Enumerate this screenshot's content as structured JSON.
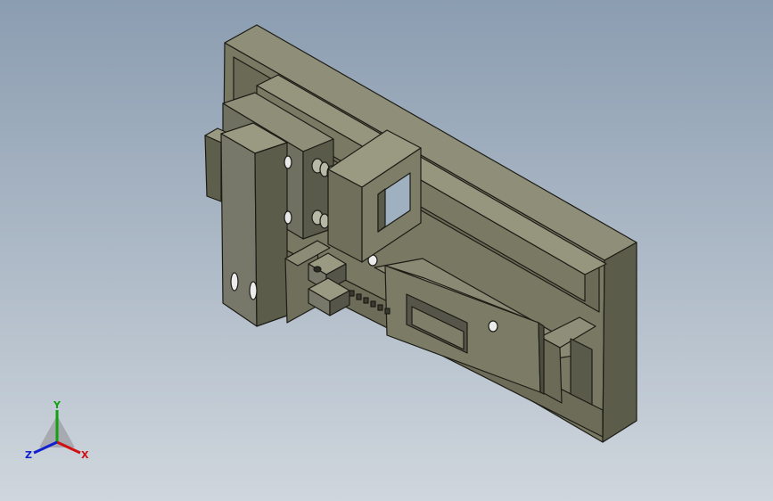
{
  "viewport": {
    "background_top": "#8b9db1",
    "background_bottom": "#cfd6dd"
  },
  "model": {
    "part_color": "#6e6e5c",
    "face_light": "#8f8f79",
    "face_mid": "#74745f",
    "face_dark": "#4e4e40",
    "edge_color": "#1c1c16"
  },
  "triad": {
    "x_label": "X",
    "y_label": "Y",
    "z_label": "Z",
    "x_color": "#d01010",
    "y_color": "#10a010",
    "z_color": "#1020d0"
  }
}
